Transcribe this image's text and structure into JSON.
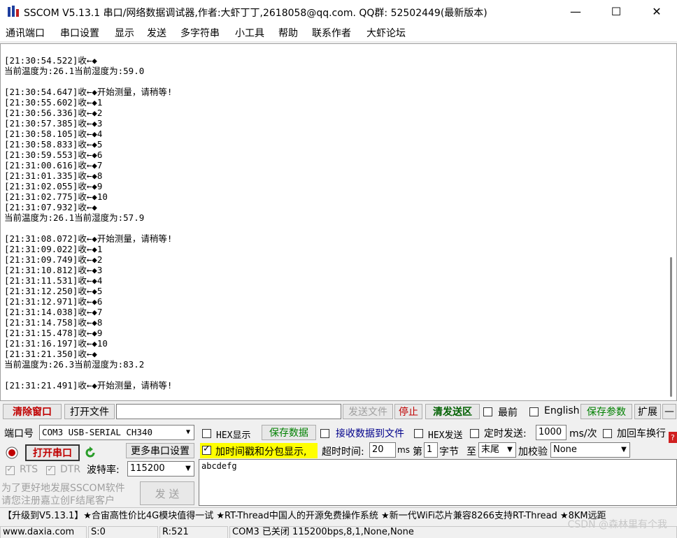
{
  "window": {
    "title": "SSCOM V5.13.1 串口/网络数据调试器,作者:大虾丁丁,2618058@qq.com. QQ群:  52502449(最新版本)",
    "minimize_glyph": "—",
    "maximize_glyph": "☐",
    "close_glyph": "✕"
  },
  "menu": [
    "通讯端口",
    "串口设置",
    "显示",
    "发送",
    "多字符串",
    "小工具",
    "帮助",
    "联系作者",
    "大虾论坛"
  ],
  "log_lines": [
    "[21:30:54.522]收←◆",
    "当前温度为:26.1当前湿度为:59.0",
    "",
    "[21:30:54.647]收←◆开始测量，请稍等!",
    "[21:30:55.602]收←◆1",
    "[21:30:56.336]收←◆2",
    "[21:30:57.385]收←◆3",
    "[21:30:58.105]收←◆4",
    "[21:30:58.833]收←◆5",
    "[21:30:59.553]收←◆6",
    "[21:31:00.616]收←◆7",
    "[21:31:01.335]收←◆8",
    "[21:31:02.055]收←◆9",
    "[21:31:02.775]收←◆10",
    "[21:31:07.932]收←◆",
    "当前温度为:26.1当前湿度为:57.9",
    "",
    "[21:31:08.072]收←◆开始测量，请稍等!",
    "[21:31:09.022]收←◆1",
    "[21:31:09.749]收←◆2",
    "[21:31:10.812]收←◆3",
    "[21:31:11.531]收←◆4",
    "[21:31:12.250]收←◆5",
    "[21:31:12.971]收←◆6",
    "[21:31:14.038]收←◆7",
    "[21:31:14.758]收←◆8",
    "[21:31:15.478]收←◆9",
    "[21:31:16.197]收←◆10",
    "[21:31:21.350]收←◆",
    "当前温度为:26.3当前湿度为:83.2",
    "",
    "[21:31:21.491]收←◆开始测量，请稍等!"
  ],
  "toolbar": {
    "clear_window": "清除窗口",
    "open_file": "打开文件",
    "send_file": "发送文件",
    "stop": "停止",
    "clear_send": "清发送区",
    "topmost": "最前",
    "english": "English",
    "save_params": "保存参数",
    "expand": "扩展",
    "collapse": "—"
  },
  "port": {
    "port_label": "端口号",
    "port_value": "COM3 USB-SERIAL CH340",
    "open_port": "打开串口",
    "more_settings": "更多串口设置",
    "rts": "RTS",
    "dtr": "DTR",
    "baud_label": "波特率:",
    "baud_value": "115200",
    "promo_line1": "为了更好地发展SSCOM软件",
    "promo_line2": "请您注册嘉立创F结尾客户"
  },
  "options": {
    "hex_display": "HEX显示",
    "save_data": "保存数据",
    "receive_to_file": "接收数据到文件",
    "hex_send": "HEX发送",
    "timed_send": "定时发送:",
    "interval": "1000",
    "interval_unit": "ms/次",
    "add_crlf": "加回车换行",
    "add_timestamp": "加时间戳和分包显示,",
    "timeout_label": "超时时间:",
    "timeout_value": "20",
    "timeout_unit": "ms",
    "byte_prefix": "第",
    "byte_value": "1",
    "byte_suffix": "字节",
    "to_label": "至",
    "to_value": "末尾",
    "checksum_label": "加校验",
    "checksum_value": "None"
  },
  "send": {
    "text": "abcdefg",
    "send_button": "发  送"
  },
  "ticker": "【升级到V5.13.1】★合宙高性价比4G模块值得一试 ★RT-Thread中国人的开源免费操作系统 ★新一代WiFi芯片兼容8266支持RT-Thread ★8KM远距",
  "status": {
    "site": "www.daxia.com",
    "sent": "S:0",
    "received": "R:521",
    "port_state": "COM3 已关闭  115200bps,8,1,None,None"
  },
  "watermark": "CSDN @森林里有个我"
}
